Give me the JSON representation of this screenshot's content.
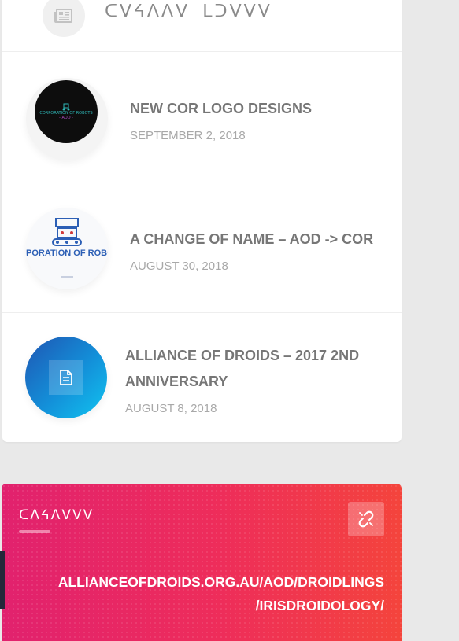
{
  "widget": {
    "title": "ᑕᐯᔦᐱᐱᐯ ᒪᑐᐯᐯᐯ",
    "icon": "newspaper-icon"
  },
  "posts": [
    {
      "title": "NEW COR LOGO DESIGNS",
      "date": "SEPTEMBER 2, 2018",
      "thumb": "cor-logo-image",
      "logo_text": "CORPORATION OF ROBOTS",
      "logo_sub": "- AOD -"
    },
    {
      "title": "A CHANGE OF NAME – AOD -> COR",
      "date": "AUGUST 30, 2018",
      "thumb": "robot-logo-image",
      "logo_text": "PORATION OF ROBOT"
    },
    {
      "title_line1": "ALLIANCE OF DROIDS – 2017 2ND",
      "title_line2": "ANNIVERSARY",
      "date": "AUGUST 8, 2018",
      "thumb": "document-icon"
    }
  ],
  "link_widget": {
    "title": "ᑕᐱᔦᐱᐯᐯᐯ",
    "icon": "link-icon",
    "url_line1": "ALLIANCEOFDROIDS.ORG.AU/AOD/DROIDLINGS",
    "url_line2": "/IRISDROIDOLOGY/"
  },
  "colors": {
    "accent_start": "#e1216e",
    "accent_end": "#f4443c",
    "thumb_gradient_start": "#1f56b3",
    "thumb_gradient_end": "#12c4f0"
  }
}
